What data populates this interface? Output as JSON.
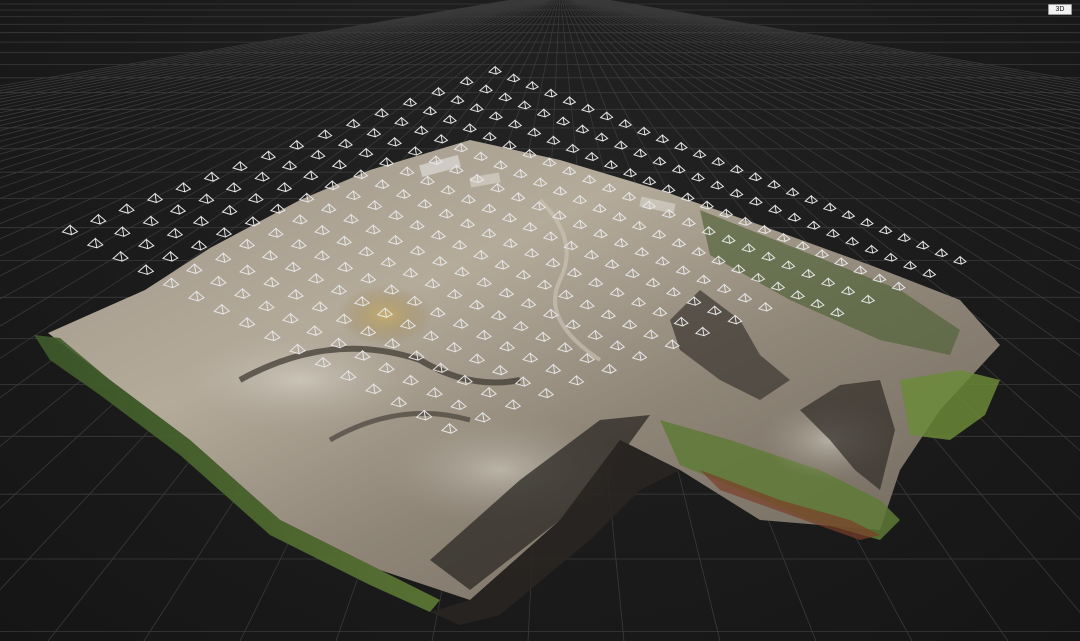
{
  "viewer": {
    "view_mode_label": "3D"
  },
  "scene": {
    "background_color": "#1a1a1a",
    "grid_color": "#3a3a3a",
    "camera_marker_color": "#e6e6e6",
    "model_description_icon": "photogrammetry-model"
  }
}
